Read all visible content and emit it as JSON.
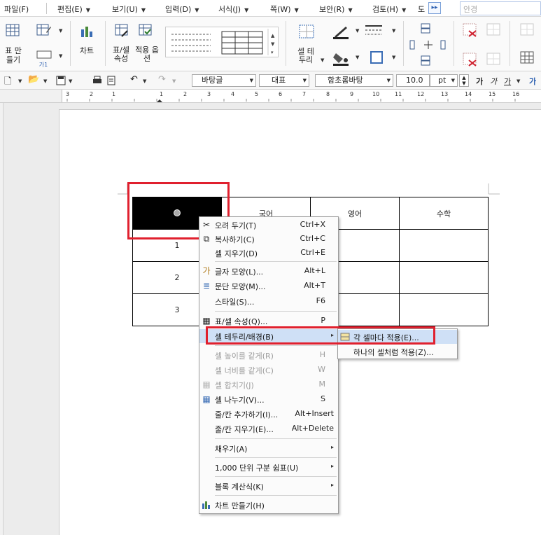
{
  "menubar": {
    "items": [
      "파일(F)",
      "편집(E)",
      "보기(U)",
      "입력(D)",
      "서식(J)",
      "쪽(W)",
      "보안(R)",
      "검토(H)",
      "도"
    ],
    "search_placeholder": "안경"
  },
  "ribbon": {
    "table_make": "표 만들기",
    "chart": "차트",
    "table_props": "표/셀 속성",
    "apply_options": "적용 옵션",
    "cell_border": "셀 테두리",
    "sub_label": "가1"
  },
  "toolbar": {
    "style": "바탕글",
    "para_style": "대표",
    "font": "함초롬바탕",
    "size": "10.0",
    "unit": "pt",
    "bold": "가",
    "italic": "가",
    "underline": "가"
  },
  "ruler": {
    "numbers": [
      "3",
      "2",
      "1",
      "1",
      "2",
      "3",
      "4",
      "5",
      "6",
      "7",
      "8",
      "9",
      "10",
      "11",
      "12",
      "13",
      "14",
      "15",
      "16"
    ]
  },
  "table": {
    "header": [
      "",
      "국어",
      "영어",
      "수학"
    ],
    "rows": [
      [
        "1",
        "",
        "",
        ""
      ],
      [
        "2",
        "",
        "",
        ""
      ],
      [
        "3",
        "",
        "",
        ""
      ]
    ]
  },
  "context_menu": {
    "items": [
      {
        "label": "오려 두기(T)",
        "shortcut": "Ctrl+X",
        "icon": "scissors-icon"
      },
      {
        "label": "복사하기(C)",
        "shortcut": "Ctrl+C",
        "icon": "copy-icon"
      },
      {
        "label": "셀 지우기(D)",
        "shortcut": "Ctrl+E",
        "icon": ""
      },
      {
        "label": "글자 모양(L)...",
        "shortcut": "Alt+L",
        "icon": "font-shape-icon"
      },
      {
        "label": "문단 모양(M)...",
        "shortcut": "Alt+T",
        "icon": "paragraph-icon"
      },
      {
        "label": "스타일(S)...",
        "shortcut": "F6",
        "icon": ""
      },
      {
        "label": "표/셀 속성(Q)...",
        "shortcut": "P",
        "icon": "table-props-icon"
      },
      {
        "label": "셀 테두리/배경(B)",
        "shortcut": "",
        "icon": ""
      },
      {
        "label": "셀 높이를 같게(R)",
        "shortcut": "H",
        "icon": ""
      },
      {
        "label": "셀 너비를 같게(C)",
        "shortcut": "W",
        "icon": ""
      },
      {
        "label": "셀 합치기(J)",
        "shortcut": "M",
        "icon": "merge-icon"
      },
      {
        "label": "셀 나누기(V)...",
        "shortcut": "S",
        "icon": "split-icon"
      },
      {
        "label": "줄/칸 추가하기(I)...",
        "shortcut": "Alt+Insert",
        "icon": ""
      },
      {
        "label": "줄/칸 지우기(E)...",
        "shortcut": "Alt+Delete",
        "icon": ""
      },
      {
        "label": "채우기(A)",
        "shortcut": "",
        "icon": ""
      },
      {
        "label": "1,000 단위 구분 쉼표(U)",
        "shortcut": "",
        "icon": ""
      },
      {
        "label": "블록 계산식(K)",
        "shortcut": "",
        "icon": ""
      },
      {
        "label": "차트 만들기(H)",
        "shortcut": "",
        "icon": "chart-icon"
      }
    ]
  },
  "submenu": {
    "items": [
      "각 셀마다 적용(E)...",
      "하나의 셀처럼 적용(Z)..."
    ]
  },
  "colors": {
    "highlight": "#cfe0f6",
    "red_box": "#e0202e"
  }
}
